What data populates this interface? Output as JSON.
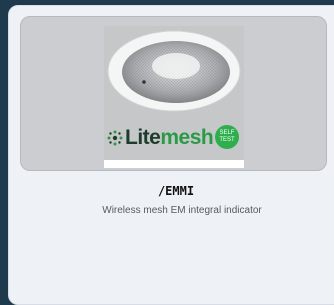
{
  "product": {
    "name": "/EMMI",
    "description": "Wireless mesh EM integral indicator",
    "image": {
      "logo_part1": "Lite",
      "logo_part2": "mesh",
      "badge_line1": "SELF",
      "badge_line2": "TEST"
    }
  },
  "colors": {
    "page_background": "#1e3a4c",
    "card_background": "#eef2f6",
    "logo_dark": "#1e3c2c",
    "logo_green": "#2a9a47",
    "badge_green": "#2fae4d"
  }
}
